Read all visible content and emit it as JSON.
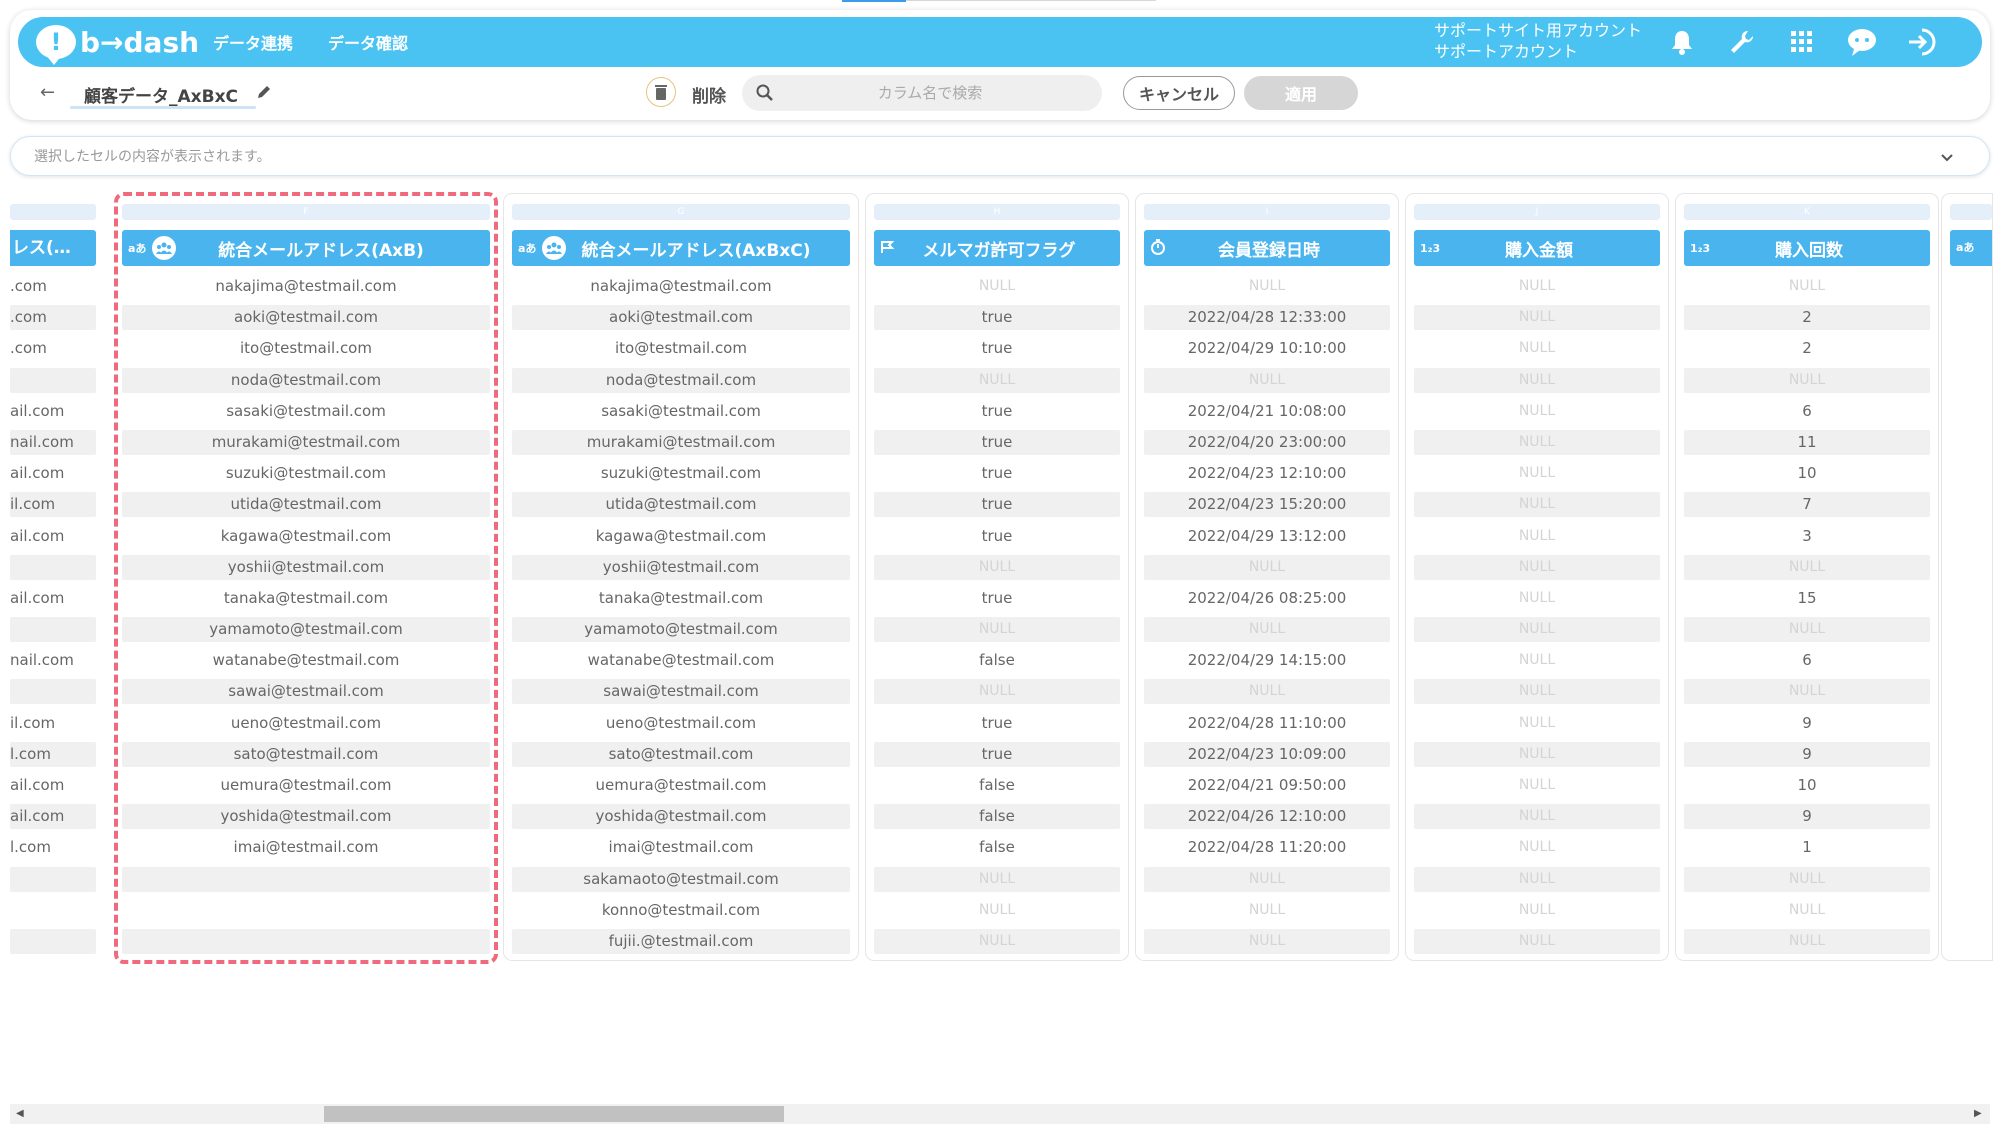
{
  "header": {
    "logo_text": "b→dash",
    "nav": [
      "データ連携",
      "データ確認"
    ],
    "account_line1": "サポートサイト用アカウント",
    "account_line2": "サポートアカウント",
    "brand_color": "#4ac3f2",
    "icons": [
      "bell-icon",
      "wrench-icon",
      "grid-icon",
      "support-chat-icon",
      "logout-icon"
    ]
  },
  "toolbar": {
    "back": "←",
    "dataset_name": "顧客データ_AxBxC",
    "delete_label": "削除",
    "search_placeholder": "カラム名で検索",
    "cancel_label": "キャンセル",
    "apply_label": "適用"
  },
  "cell_preview": {
    "placeholder": "選択したセルの内容が表示されます。"
  },
  "partial_left": {
    "header": "レス(…",
    "rows": [
      ".com",
      ".com",
      ".com",
      "",
      "ail.com",
      "nail.com",
      "ail.com",
      "il.com",
      "ail.com",
      "",
      "ail.com",
      "",
      "nail.com",
      "",
      "il.com",
      "l.com",
      "ail.com",
      "ail.com",
      "l.com",
      "",
      "",
      ""
    ]
  },
  "partial_right": {
    "type": "aあ"
  },
  "columns": [
    {
      "letter": "F",
      "type": "aあ",
      "group": true,
      "title": "統合メールアドレス(AxB)",
      "rows": [
        "nakajima@testmail.com",
        "aoki@testmail.com",
        "ito@testmail.com",
        "noda@testmail.com",
        "sasaki@testmail.com",
        "murakami@testmail.com",
        "suzuki@testmail.com",
        "utida@testmail.com",
        "kagawa@testmail.com",
        "yoshii@testmail.com",
        "tanaka@testmail.com",
        "yamamoto@testmail.com",
        "watanabe@testmail.com",
        "sawai@testmail.com",
        "ueno@testmail.com",
        "sato@testmail.com",
        "uemura@testmail.com",
        "yoshida@testmail.com",
        "imai@testmail.com",
        "",
        "",
        ""
      ]
    },
    {
      "letter": "G",
      "type": "aあ",
      "group": true,
      "title": "統合メールアドレス(AxBxC)",
      "rows": [
        "nakajima@testmail.com",
        "aoki@testmail.com",
        "ito@testmail.com",
        "noda@testmail.com",
        "sasaki@testmail.com",
        "murakami@testmail.com",
        "suzuki@testmail.com",
        "utida@testmail.com",
        "kagawa@testmail.com",
        "yoshii@testmail.com",
        "tanaka@testmail.com",
        "yamamoto@testmail.com",
        "watanabe@testmail.com",
        "sawai@testmail.com",
        "ueno@testmail.com",
        "sato@testmail.com",
        "uemura@testmail.com",
        "yoshida@testmail.com",
        "imai@testmail.com",
        "sakamaoto@testmail.com",
        "konno@testmail.com",
        "fujii.@testmail.com"
      ]
    },
    {
      "letter": "H",
      "type": "flag",
      "group": false,
      "title": "メルマガ許可フラグ",
      "rows": [
        "NULL",
        "true",
        "true",
        "NULL",
        "true",
        "true",
        "true",
        "true",
        "true",
        "NULL",
        "true",
        "NULL",
        "false",
        "NULL",
        "true",
        "true",
        "false",
        "false",
        "false",
        "NULL",
        "NULL",
        "NULL"
      ]
    },
    {
      "letter": "I",
      "type": "clock",
      "group": false,
      "title": "会員登録日時",
      "rows": [
        "NULL",
        "2022/04/28 12:33:00",
        "2022/04/29 10:10:00",
        "NULL",
        "2022/04/21 10:08:00",
        "2022/04/20 23:00:00",
        "2022/04/23 12:10:00",
        "2022/04/23 15:20:00",
        "2022/04/29 13:12:00",
        "NULL",
        "2022/04/26 08:25:00",
        "NULL",
        "2022/04/29 14:15:00",
        "NULL",
        "2022/04/28 11:10:00",
        "2022/04/23 10:09:00",
        "2022/04/21 09:50:00",
        "2022/04/26 12:10:00",
        "2022/04/28 11:20:00",
        "NULL",
        "NULL",
        "NULL"
      ]
    },
    {
      "letter": "J",
      "type": "1₂3",
      "group": false,
      "title": "購入金額",
      "rows": [
        "NULL",
        "NULL",
        "NULL",
        "NULL",
        "NULL",
        "NULL",
        "NULL",
        "NULL",
        "NULL",
        "NULL",
        "NULL",
        "NULL",
        "NULL",
        "NULL",
        "NULL",
        "NULL",
        "NULL",
        "NULL",
        "NULL",
        "NULL",
        "NULL",
        "NULL"
      ]
    },
    {
      "letter": "K",
      "type": "1₂3",
      "group": false,
      "title": "購入回数",
      "rows": [
        "NULL",
        "2",
        "2",
        "NULL",
        "6",
        "11",
        "10",
        "7",
        "3",
        "NULL",
        "15",
        "NULL",
        "6",
        "NULL",
        "9",
        "9",
        "10",
        "9",
        "1",
        "NULL",
        "NULL",
        "NULL"
      ]
    }
  ]
}
